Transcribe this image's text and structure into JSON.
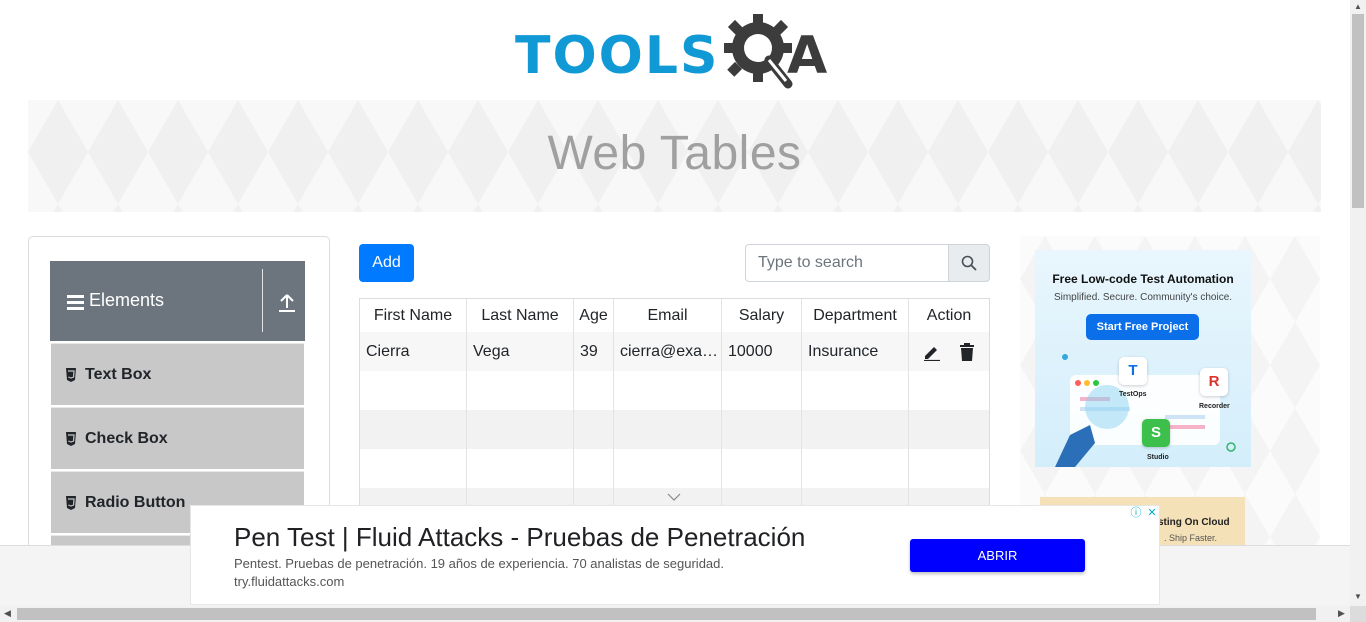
{
  "logo": {
    "text_tools": "TOOLS",
    "text_a": "A",
    "colors": {
      "tools": "#1199d6",
      "qa": "#3c3c3c"
    }
  },
  "banner": {
    "title": "Web Tables"
  },
  "sidebar": {
    "group_title": "Elements",
    "items": [
      {
        "label": "Text Box"
      },
      {
        "label": "Check Box"
      },
      {
        "label": "Radio Button"
      }
    ]
  },
  "toolbar": {
    "add_label": "Add",
    "search_placeholder": "Type to search"
  },
  "table": {
    "headers": [
      "First Name",
      "Last Name",
      "Age",
      "Email",
      "Salary",
      "Department",
      "Action"
    ],
    "rows": [
      {
        "first_name": "Cierra",
        "last_name": "Vega",
        "age": "39",
        "email": "cierra@example.com",
        "salary": "10000",
        "department": "Insurance"
      }
    ]
  },
  "side_ad": {
    "title": "Free Low-code Test Automation",
    "subtitle": "Simplified. Secure. Community's choice.",
    "cta": "Start Free Project",
    "badges": [
      {
        "letter": "T",
        "label": "TestOps"
      },
      {
        "letter": "R",
        "label": "Recorder"
      },
      {
        "letter": "S",
        "label": "Studio"
      }
    ]
  },
  "side_ad2": {
    "title": "sting On Cloud",
    "subtitle": ". Ship Faster."
  },
  "bottom_ad": {
    "headline": "Pen Test | Fluid Attacks - Pruebas de Penetración",
    "description": "Pentest. Pruebas de penetración. 19 años de experiencia. 70 analistas de seguridad.",
    "url": "try.fluidattacks.com",
    "button": "ABRIR"
  },
  "colors": {
    "primary": "#007bff",
    "sidebar_header": "#6c757d",
    "sidebar_item": "#c8c8c8",
    "ad_button": "#0000ff"
  }
}
